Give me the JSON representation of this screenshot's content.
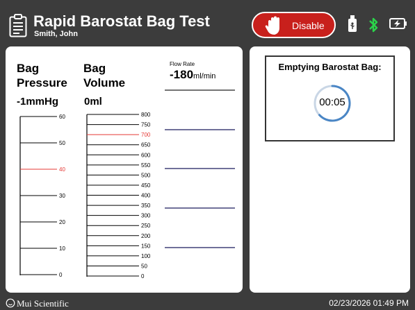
{
  "header": {
    "title": "Rapid Barostat Bag Test",
    "patient": "Smith, John",
    "disable_label": "Disable",
    "icons": [
      "clipboard-icon",
      "hand-stop-icon",
      "usb-icon",
      "bluetooth-icon",
      "battery-charging-icon"
    ]
  },
  "pressure": {
    "label_line1": "Bag",
    "label_line2": "Pressure",
    "value": "-1mmHg",
    "scale": [
      "60",
      "50",
      "40",
      "30",
      "20",
      "10",
      "0"
    ],
    "highlighted_tick": "40"
  },
  "volume": {
    "label_line1": "Bag",
    "label_line2": "Volume",
    "value": "0ml",
    "scale": [
      "800",
      "750",
      "700",
      "650",
      "600",
      "550",
      "500",
      "450",
      "400",
      "350",
      "300",
      "250",
      "200",
      "150",
      "100",
      "50",
      "0"
    ],
    "highlighted_tick": "700"
  },
  "flow": {
    "label": "Flow Rate",
    "value": "-180",
    "unit": "ml/min"
  },
  "emptying": {
    "title": "Emptying Barostat Bag:",
    "timer": "00:05"
  },
  "footer": {
    "brand": "Mui Scientific",
    "datetime": "02/23/2026 01:49 PM"
  },
  "colors": {
    "background": "#3c3c3c",
    "disable_button": "#c8201c",
    "highlight_tick": "#e53935",
    "bluetooth": "#2bd34a",
    "flow_lines": "#1a1a5c",
    "timer_ring": "#4a86c5"
  }
}
